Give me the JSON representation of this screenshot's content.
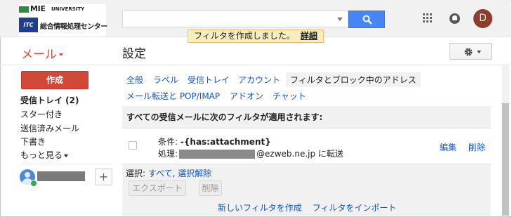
{
  "logo": {
    "name": "MIE",
    "university": "UNIVERSITY",
    "box_text": "ITC",
    "center_name": "総合情報処理センター"
  },
  "search": {
    "value": "",
    "placeholder": ""
  },
  "account": {
    "initial": "D"
  },
  "toast": {
    "message": "フィルタを作成しました。",
    "detail": "詳細"
  },
  "app_switcher": {
    "label": "メール"
  },
  "page": {
    "title": "設定"
  },
  "sidebar": {
    "compose": "作成",
    "items": [
      {
        "label": "受信トレイ (2)"
      },
      {
        "label": "スター付き"
      },
      {
        "label": "送信済みメール"
      },
      {
        "label": "下書き"
      },
      {
        "label": "もっと見る"
      }
    ],
    "add_label": "+"
  },
  "tabs": [
    {
      "label": "全般"
    },
    {
      "label": "ラベル"
    },
    {
      "label": "受信トレイ"
    },
    {
      "label": "アカウント"
    },
    {
      "label": "フィルタとブロック中のアドレス"
    },
    {
      "label": "メール転送と POP/IMAP"
    },
    {
      "label": "アドオン"
    },
    {
      "label": "チャット"
    }
  ],
  "filters": {
    "heading": "すべての受信メールに次のフィルタが適用されます:",
    "items": [
      {
        "condition_label": "条件:",
        "condition_value": "-{has:attachment}",
        "action_label": "処理:",
        "action_suffix": "@ezweb.ne.jp に転送",
        "edit": "編集",
        "delete": "削除"
      }
    ],
    "select_label": "選択:",
    "select_all": "すべて",
    "select_none": "選択解除",
    "export_button": "エクスポート",
    "delete_button": "削除",
    "create_new": "新しいフィルタを作成",
    "import": "フィルタをインポート"
  },
  "colors": {
    "accent_red": "#dd4b39",
    "compose_red": "#d14836",
    "search_blue": "#4486f6",
    "link_blue": "#1155cc",
    "toast_yellow": "#f9edbe"
  }
}
